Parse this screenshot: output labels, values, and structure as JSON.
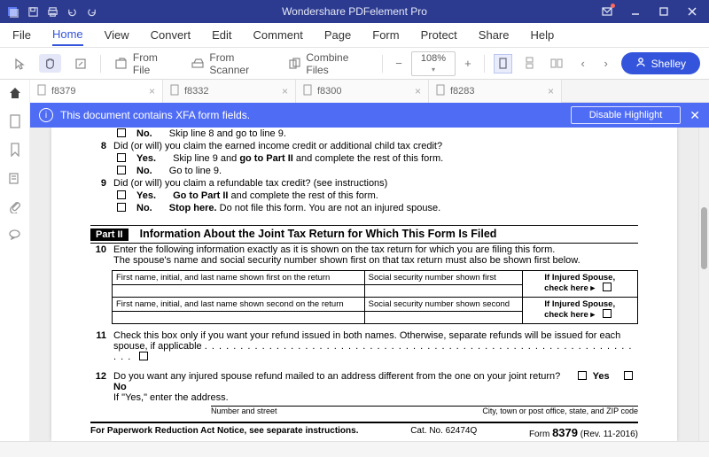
{
  "app": {
    "title": "Wondershare PDFelement Pro"
  },
  "menu": [
    "File",
    "Home",
    "View",
    "Convert",
    "Edit",
    "Comment",
    "Page",
    "Form",
    "Protect",
    "Share",
    "Help"
  ],
  "menu_active": "Home",
  "toolbar": {
    "from_file": "From File",
    "from_scanner": "From Scanner",
    "combine": "Combine Files",
    "zoom": "108%",
    "user": "Shelley"
  },
  "tabs": [
    {
      "name": "f8379",
      "active": true
    },
    {
      "name": "f8332",
      "active": false
    },
    {
      "name": "f8300",
      "active": false
    },
    {
      "name": "f8283",
      "active": false
    }
  ],
  "banner": {
    "msg": "This document contains XFA form fields.",
    "button": "Disable Highlight"
  },
  "doc": {
    "line7_no": "No.",
    "line7_no_txt": "Skip line 8 and go to line 9.",
    "line8_num": "8",
    "line8_q": "Did (or will) you claim the earned income credit or additional child tax credit?",
    "line8_yes": "Yes.",
    "line8_yes_txt_a": "Skip line 9 and ",
    "line8_yes_txt_b": "go to Part II",
    "line8_yes_txt_c": " and complete the rest of this form.",
    "line8_no": "No.",
    "line8_no_txt": "Go to line 9.",
    "line9_num": "9",
    "line9_q": "Did (or will) you claim a refundable tax credit? (see instructions)",
    "line9_yes": "Yes.",
    "line9_yes_txt_a": "Go to Part II",
    "line9_yes_txt_c": " and complete the rest of this form.",
    "line9_no": "No.",
    "line9_no_txt_a": "Stop here.",
    "line9_no_txt_b": " Do not file this form. You are not an injured spouse.",
    "part2_badge": "Part II",
    "part2_title": "Information About the Joint Tax Return for Which This Form Is Filed",
    "line10_num": "10",
    "line10_a": "Enter the following information exactly as it is shown on the tax return for which you are filing this form.",
    "line10_b": "The spouse's name and social security number shown first on that tax return must also be shown first below.",
    "tbl_name1": "First name, initial, and last name shown first on the return",
    "tbl_ssn1": "Social security number shown first",
    "tbl_inj": "If Injured Spouse,",
    "tbl_check": "check here ▸",
    "tbl_name2": "First name, initial, and last name shown second on the return",
    "tbl_ssn2": "Social security number shown second",
    "line11_num": "11",
    "line11": "Check this box only if you want your refund issued in both names. Otherwise, separate refunds will be issued for each spouse, if applicable",
    "dots": ". . . . . . . . . . . . . . . . . . . . . . . . . . . . . . . . . . . . . . . . . . . . . . . . . . . . . . . . . . . . . . .",
    "line12_num": "12",
    "line12_a": "Do you want any injured spouse refund mailed to an address different from the one on your joint return?",
    "yes": "Yes",
    "no": "No",
    "line12_b": "If \"Yes,\" enter the address.",
    "addr_lbl_left": "Number and street",
    "addr_lbl_right": "City, town or post office, state, and ZIP code",
    "footer_left": "For Paperwork Reduction Act Notice, see separate instructions.",
    "footer_mid": "Cat. No. 62474Q",
    "footer_form_word": "Form ",
    "footer_form_no": "8379",
    "footer_rev": " (Rev. 11-2016)"
  }
}
